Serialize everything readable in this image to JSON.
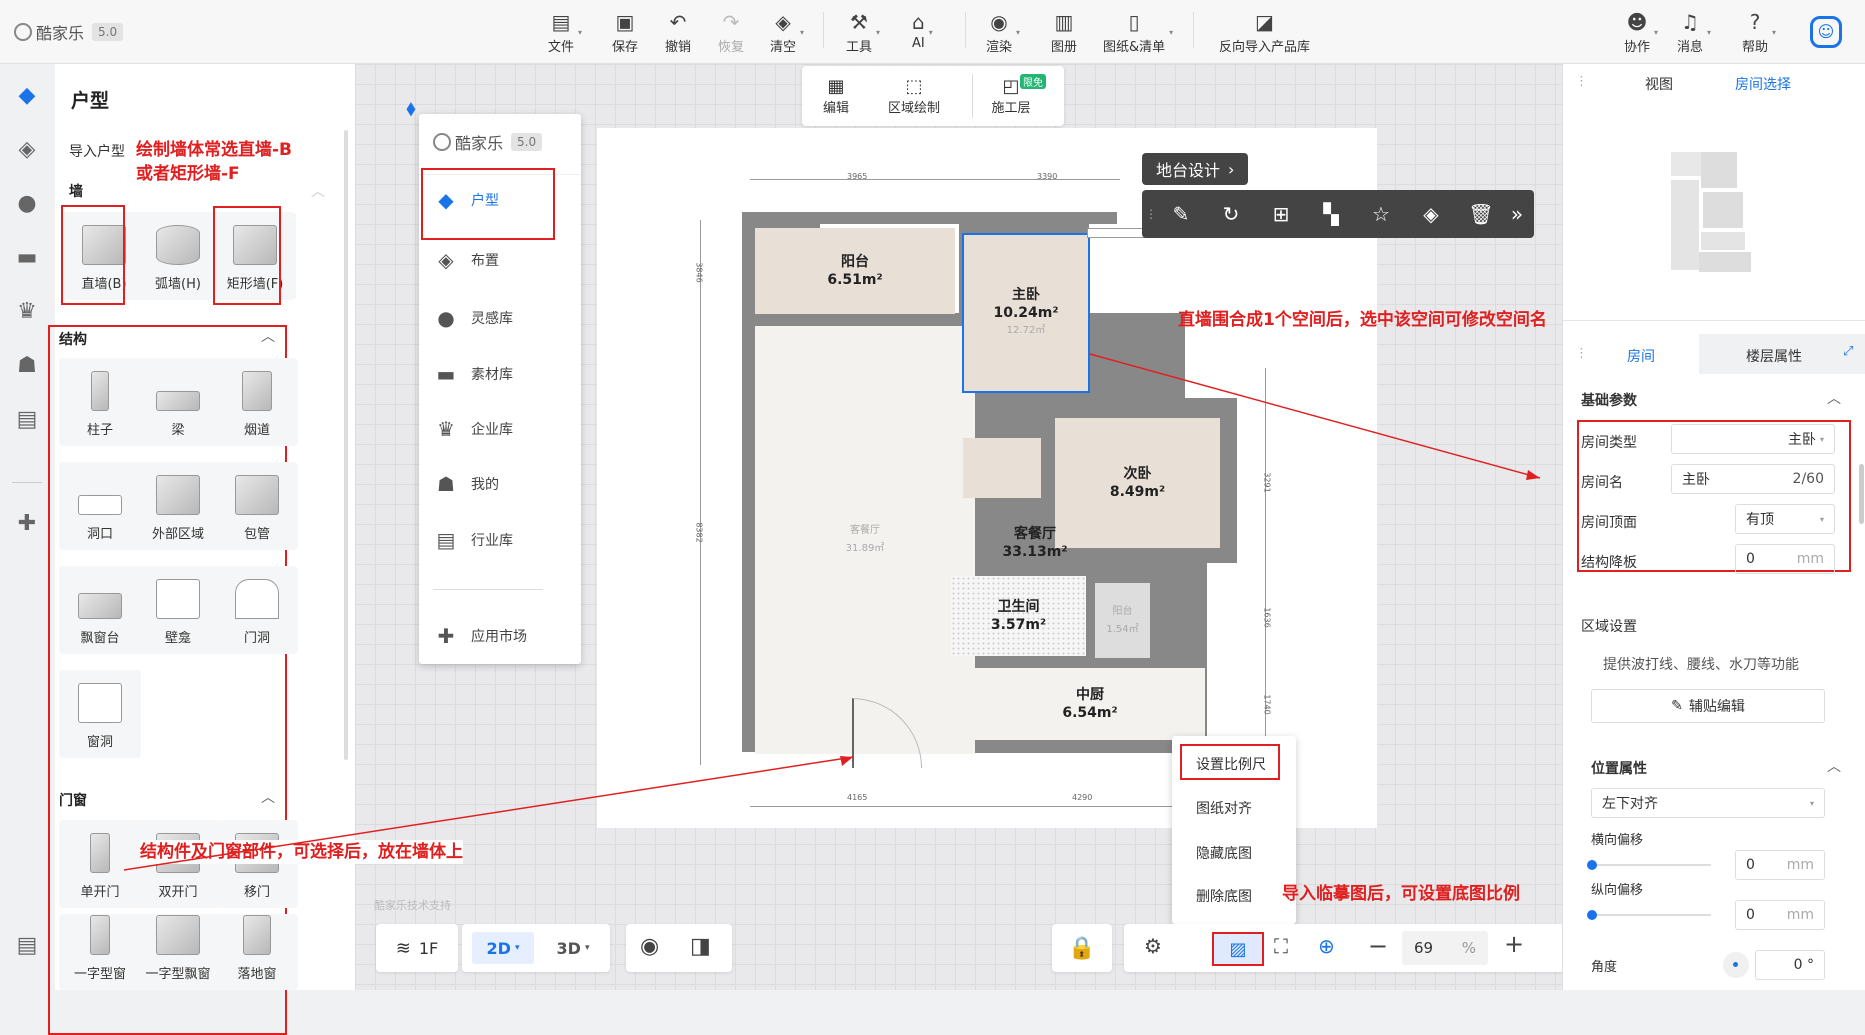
{
  "app": {
    "logo": "酷家乐",
    "version": "5.0"
  },
  "toolbar": [
    {
      "label": "文件",
      "icon": "file-icon"
    },
    {
      "label": "保存",
      "icon": "save-icon"
    },
    {
      "label": "撤销",
      "icon": "undo-icon"
    },
    {
      "label": "恢复",
      "icon": "redo-icon"
    },
    {
      "label": "清空",
      "icon": "eraser-icon"
    },
    {
      "label": "工具",
      "icon": "wrench-icon"
    },
    {
      "label": "AI",
      "icon": "ai-icon"
    },
    {
      "label": "渲染",
      "icon": "render-icon"
    },
    {
      "label": "图册",
      "icon": "album-icon"
    },
    {
      "label": "图纸&清单",
      "icon": "drawing-icon"
    },
    {
      "label": "反向导入产品库",
      "icon": "import-icon"
    }
  ],
  "toolbar_right": [
    {
      "label": "协作"
    },
    {
      "label": "消息"
    },
    {
      "label": "帮助"
    }
  ],
  "left_panel": {
    "title": "户型",
    "import": "导入户型",
    "wall_section": "墙",
    "walls": [
      "直墙(B)",
      "弧墙(H)",
      "矩形墙(F)"
    ],
    "structure_section": "结构",
    "structures": [
      "柱子",
      "梁",
      "烟道",
      "洞口",
      "外部区域",
      "包管",
      "飘窗台",
      "壁龛",
      "门洞",
      "窗洞"
    ],
    "doorwin_section": "门窗",
    "doors": [
      "单开门",
      "双开门",
      "移门",
      "一字型窗",
      "一字型飘窗",
      "落地窗"
    ]
  },
  "annotations": {
    "wall_tip1": "绘制墙体常选直墙-B",
    "wall_tip2": "或者矩形墙-F",
    "space_tip": "直墙围合成1个空间后，选中该空间可修改空间名",
    "struct_tip": "结构件及门窗部件，可选择后，放在墙体上",
    "scale_tip": "导入临摹图后，可设置底图比例"
  },
  "canvas_toolbar": [
    {
      "label": "编辑"
    },
    {
      "label": "区域绘制"
    },
    {
      "label": "施工层",
      "badge": "限免"
    }
  ],
  "popup": {
    "logo": "酷家乐",
    "version": "5.0",
    "items": [
      {
        "label": "户型",
        "active": true
      },
      {
        "label": "布置"
      },
      {
        "label": "灵感库"
      },
      {
        "label": "素材库"
      },
      {
        "label": "企业库"
      },
      {
        "label": "我的"
      },
      {
        "label": "行业库"
      },
      {
        "label": "应用市场"
      }
    ]
  },
  "balcony_btn": "地台设计",
  "rooms": [
    {
      "name": "阳台",
      "area": "6.51m²"
    },
    {
      "name": "主卧",
      "area": "10.24m²",
      "ghost": "12.72㎡"
    },
    {
      "name": "次卧",
      "area": "8.49m²"
    },
    {
      "name": "客餐厅",
      "area": "33.13m²",
      "ghost": "客餐厅",
      "ghost2": "31.89㎡"
    },
    {
      "name": "卫生间",
      "area": "3.57m²"
    },
    {
      "name": "中厨",
      "area": "6.54m²"
    },
    {
      "name": "阳台",
      "area": "",
      "ghost2": "1.54㎡"
    }
  ],
  "dims": {
    "top": [
      "3965",
      "3390"
    ],
    "bottom": [
      "4165",
      "4290"
    ],
    "left": [
      "3846",
      "8382"
    ],
    "right": [
      "3291",
      "1636",
      "1740"
    ]
  },
  "context_menu": [
    "设置比例尺",
    "图纸对齐",
    "隐藏底图",
    "删除底图"
  ],
  "support": "酷家乐技术支持",
  "bottom": {
    "layer": "1F",
    "mode2d": "2D",
    "mode3d": "3D",
    "zoom": "69",
    "unit": "%"
  },
  "right_panel": {
    "tabs_top": [
      "视图",
      "房间选择"
    ],
    "tabs_mid": [
      "房间",
      "楼层属性"
    ],
    "basic": "基础参数",
    "room_type_label": "房间类型",
    "room_type": "主卧",
    "room_name_label": "房间名",
    "room_name": "主卧",
    "room_name_count": "2/60",
    "ceiling_label": "房间顶面",
    "ceiling": "有顶",
    "drop_label": "结构降板",
    "drop": "0",
    "drop_unit": "mm",
    "area_setting": "区域设置",
    "area_desc": "提供波打线、腰线、水刀等功能",
    "paste_btn": "辅贴编辑",
    "pos_section": "位置属性",
    "align": "左下对齐",
    "h_offset_label": "横向偏移",
    "h_offset": "0",
    "v_offset_label": "纵向偏移",
    "v_offset": "0",
    "unit": "mm",
    "angle_label": "角度",
    "angle": "0 °"
  },
  "colors": {
    "accent": "#1a73e8",
    "red": "#e02020",
    "room_fill": "#e8e0d7",
    "wall": "#888888"
  }
}
